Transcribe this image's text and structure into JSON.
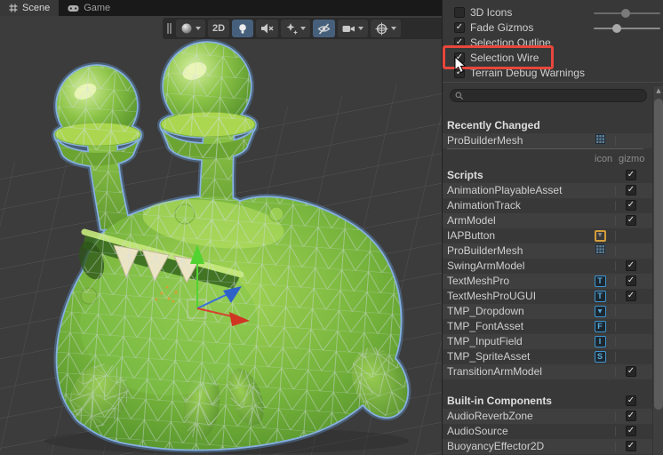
{
  "window": {
    "tabs": [
      {
        "label": "Scene",
        "icon": "scene-grid-icon",
        "active": true
      },
      {
        "label": "Game",
        "icon": "gamepad-icon",
        "active": false
      }
    ]
  },
  "scene_toolbar": {
    "toggle_2d_label": "2D",
    "buttons": [
      {
        "name": "shading-mode",
        "icon": "shaded-sphere-icon",
        "dropdown": true,
        "active": false
      },
      {
        "name": "2d-toggle",
        "label": "2D",
        "active": false
      },
      {
        "name": "lighting-toggle",
        "icon": "lightbulb-icon",
        "active": true
      },
      {
        "name": "audio-toggle",
        "icon": "audio-muted-icon",
        "active": false
      },
      {
        "name": "effects-toggle",
        "icon": "effects-sparkle-icon",
        "dropdown": true,
        "active": false
      },
      {
        "name": "visibility-toggle",
        "icon": "eye-hidden-icon",
        "active": true
      },
      {
        "name": "camera-toggle",
        "icon": "camera-icon",
        "dropdown": true,
        "active": false
      },
      {
        "name": "gizmos-selector",
        "icon": "gizmo-sphere-icon",
        "dropdown": true,
        "active": false
      }
    ]
  },
  "gizmos_panel": {
    "options": [
      {
        "label": "3D Icons",
        "checked": false,
        "slider": true,
        "value_pct": 48,
        "enabled": false
      },
      {
        "label": "Fade Gizmos",
        "checked": true,
        "slider": true,
        "value_pct": 35,
        "enabled": true
      },
      {
        "label": "Selection Outline",
        "checked": true
      },
      {
        "label": "Selection Wire",
        "checked": true,
        "highlighted": true
      },
      {
        "label": "Terrain Debug Warnings",
        "checked": true
      }
    ],
    "search": {
      "placeholder": ""
    },
    "columns": {
      "icon": "icon",
      "gizmo": "gizmo"
    },
    "sections": [
      {
        "header": "Recently Changed",
        "header_checkbox": false,
        "items": [
          {
            "name": "ProBuilderMesh",
            "icon": "probuilder-grid-icon"
          }
        ]
      },
      {
        "header": "Scripts",
        "header_checkbox": true,
        "header_checked": true,
        "items": [
          {
            "name": "AnimationPlayableAsset",
            "gizmo": true
          },
          {
            "name": "AnimationTrack",
            "gizmo": true
          },
          {
            "name": "ArmModel",
            "gizmo": true
          },
          {
            "name": "IAPButton",
            "icon": "iap-button-icon"
          },
          {
            "name": "ProBuilderMesh",
            "icon": "probuilder-grid-icon"
          },
          {
            "name": "SwingArmModel",
            "gizmo": true
          },
          {
            "name": "TextMeshPro",
            "icon": "tmp-letter-T-icon",
            "gizmo": true
          },
          {
            "name": "TextMeshProUGUI",
            "icon": "tmp-letter-T-icon",
            "gizmo": true
          },
          {
            "name": "TMP_Dropdown",
            "icon": "tmp-dropdown-icon"
          },
          {
            "name": "TMP_FontAsset",
            "icon": "tmp-letter-F-icon"
          },
          {
            "name": "TMP_InputField",
            "icon": "tmp-letter-I-icon"
          },
          {
            "name": "TMP_SpriteAsset",
            "icon": "tmp-letter-S-icon"
          },
          {
            "name": "TransitionArmModel",
            "gizmo": true
          }
        ]
      },
      {
        "header": "Built-in Components",
        "header_checkbox": true,
        "header_checked": true,
        "items": [
          {
            "name": "AudioReverbZone",
            "gizmo": true
          },
          {
            "name": "AudioSource",
            "gizmo": true
          },
          {
            "name": "BuoyancyEffector2D",
            "gizmo": true
          }
        ]
      }
    ]
  },
  "annotation": {
    "highlight_color": "#e8473c"
  },
  "colors": {
    "active_button": "#46607c",
    "selection_outline": "#7fa8d8",
    "axis_y_green": "#52d331",
    "axis_z_blue": "#2f62c8",
    "axis_x_red": "#cf3522"
  }
}
